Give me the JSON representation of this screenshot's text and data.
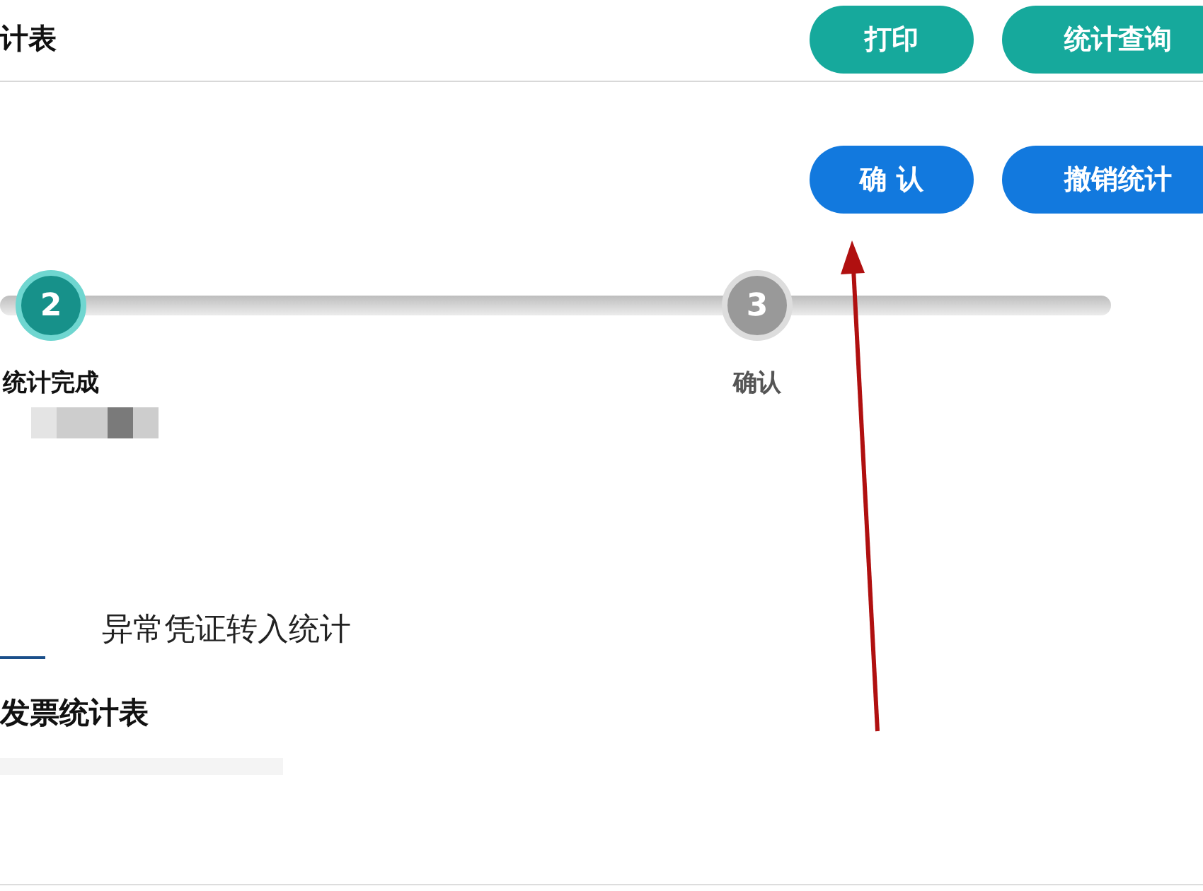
{
  "header": {
    "title": "计表",
    "buttons": [
      {
        "label": "打印",
        "kind": "teal"
      },
      {
        "label": "统计查询",
        "kind": "teal"
      }
    ]
  },
  "actions": [
    {
      "label": "确 认",
      "kind": "blue"
    },
    {
      "label": "撤销统计",
      "kind": "blue"
    }
  ],
  "steps": [
    {
      "number": "2",
      "label": "统计完成",
      "selected": true
    },
    {
      "number": "3",
      "label": "确认",
      "selected": false
    }
  ],
  "tab": {
    "label": "异常凭证转入统计"
  },
  "section": {
    "title": "发票统计表"
  }
}
